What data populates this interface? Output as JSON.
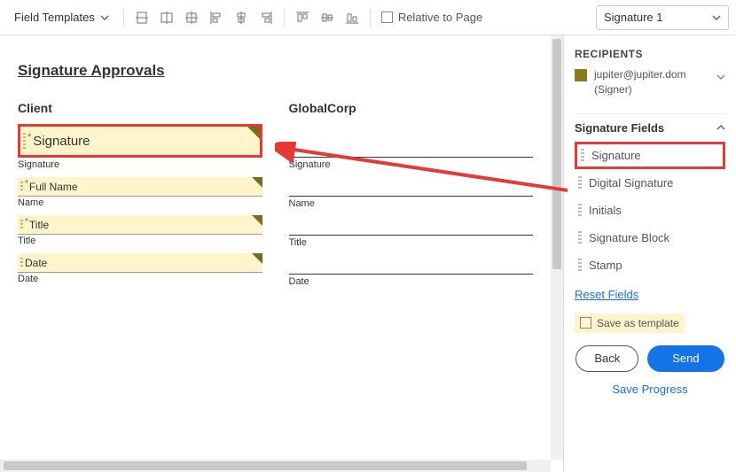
{
  "toolbar": {
    "field_templates_label": "Field Templates",
    "relative_to_page_label": "Relative to Page",
    "signer_select_value": "Signature 1"
  },
  "document": {
    "title": "Signature Approvals",
    "columns": [
      {
        "header": "Client",
        "fields": [
          {
            "label": "Signature",
            "placeholder": "Signature",
            "required": true,
            "type": "signature",
            "highlighted": true
          },
          {
            "label": "Name",
            "placeholder": "Full Name",
            "required": true,
            "type": "text"
          },
          {
            "label": "Title",
            "placeholder": "Title",
            "required": true,
            "type": "text"
          },
          {
            "label": "Date",
            "placeholder": "Date",
            "required": false,
            "type": "text"
          }
        ]
      },
      {
        "header": "GlobalCorp",
        "fields": [
          {
            "label": "Signature",
            "type": "empty"
          },
          {
            "label": "Name",
            "type": "empty"
          },
          {
            "label": "Title",
            "type": "empty"
          },
          {
            "label": "Date",
            "type": "empty"
          }
        ]
      }
    ]
  },
  "right_panel": {
    "recipients_title": "RECIPIENTS",
    "recipient_email": "jupiter@jupiter.dom",
    "recipient_role": "(Signer)",
    "signature_fields_title": "Signature Fields",
    "field_types": [
      "Signature",
      "Digital Signature",
      "Initials",
      "Signature Block",
      "Stamp"
    ],
    "reset_fields_label": "Reset Fields",
    "save_as_template_label": "Save as template",
    "back_label": "Back",
    "send_label": "Send",
    "save_progress_label": "Save Progress"
  },
  "annotation": {
    "highlight_color": "#e53935"
  }
}
